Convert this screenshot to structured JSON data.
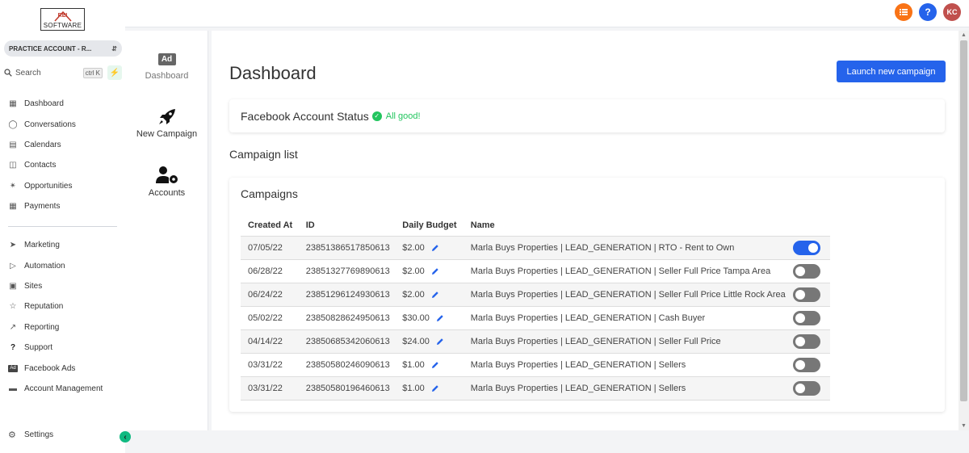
{
  "logo": {
    "top": "REI",
    "bottom": "SOFTWARE"
  },
  "account": {
    "name": "PRACTICE ACCOUNT - R..."
  },
  "search": {
    "label": "Search",
    "shortcut": "ctrl K"
  },
  "sidebar": {
    "items": [
      {
        "label": "Dashboard",
        "icon": "grid-icon"
      },
      {
        "label": "Conversations",
        "icon": "chat-bubble-icon"
      },
      {
        "label": "Calendars",
        "icon": "calendar-icon"
      },
      {
        "label": "Contacts",
        "icon": "contact-card-icon"
      },
      {
        "label": "Opportunities",
        "icon": "funnel-icon"
      },
      {
        "label": "Payments",
        "icon": "receipt-icon"
      }
    ],
    "items2": [
      {
        "label": "Marketing",
        "icon": "paper-plane-icon"
      },
      {
        "label": "Automation",
        "icon": "play-circle-icon"
      },
      {
        "label": "Sites",
        "icon": "globe-window-icon"
      },
      {
        "label": "Reputation",
        "icon": "star-icon"
      },
      {
        "label": "Reporting",
        "icon": "trend-icon"
      },
      {
        "label": "Support",
        "icon": "question-icon"
      },
      {
        "label": "Facebook Ads",
        "icon": "ad-icon"
      },
      {
        "label": "Account Management",
        "icon": "card-icon"
      }
    ],
    "settings": "Settings"
  },
  "topbar": {
    "avatar_initials": "KC",
    "help": "?"
  },
  "subnav": {
    "dashboard": "Dashboard",
    "ad_badge": "Ad",
    "new_campaign": "New Campaign",
    "accounts": "Accounts"
  },
  "main": {
    "title": "Dashboard",
    "launch_button": "Launch new campaign",
    "status_label": "Facebook Account Status",
    "status_value": "All good!",
    "campaign_list_label": "Campaign list",
    "campaigns_title": "Campaigns",
    "columns": [
      "Created At",
      "ID",
      "Daily Budget",
      "Name"
    ],
    "rows": [
      {
        "created": "07/05/22",
        "id": "23851386517850613",
        "budget": "$2.00",
        "name": "Marla Buys Properties | LEAD_GENERATION | RTO - Rent to Own",
        "active": true
      },
      {
        "created": "06/28/22",
        "id": "23851327769890613",
        "budget": "$2.00",
        "name": "Marla Buys Properties | LEAD_GENERATION | Seller Full Price Tampa Area",
        "active": false
      },
      {
        "created": "06/24/22",
        "id": "23851296124930613",
        "budget": "$2.00",
        "name": "Marla Buys Properties | LEAD_GENERATION | Seller Full Price Little Rock Area",
        "active": false
      },
      {
        "created": "05/02/22",
        "id": "23850828624950613",
        "budget": "$30.00",
        "name": "Marla Buys Properties | LEAD_GENERATION | Cash Buyer",
        "active": false
      },
      {
        "created": "04/14/22",
        "id": "23850685342060613",
        "budget": "$24.00",
        "name": "Marla Buys Properties | LEAD_GENERATION | Seller Full Price",
        "active": false
      },
      {
        "created": "03/31/22",
        "id": "23850580246090613",
        "budget": "$1.00",
        "name": "Marla Buys Properties | LEAD_GENERATION | Sellers",
        "active": false
      },
      {
        "created": "03/31/22",
        "id": "23850580196460613",
        "budget": "$1.00",
        "name": "Marla Buys Properties | LEAD_GENERATION | Sellers",
        "active": false
      }
    ]
  },
  "colors": {
    "accent": "#2563eb",
    "success": "#22c55e",
    "orange": "#f97316",
    "avatar": "#c0504d"
  }
}
